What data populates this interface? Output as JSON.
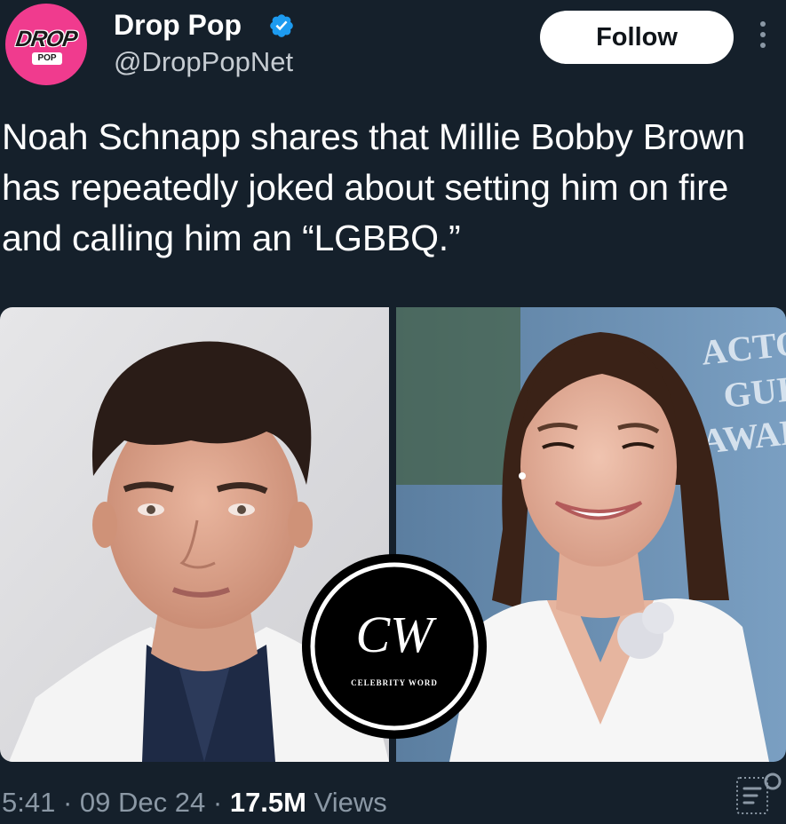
{
  "account": {
    "display_name": "Drop Pop",
    "handle": "@DropPopNet",
    "verified": true,
    "avatar": {
      "logo_text": "DROP",
      "logo_subtext": "POP",
      "background": "#f03b8e"
    }
  },
  "actions": {
    "follow_label": "Follow",
    "more_icon": "more-vertical-icon"
  },
  "tweet": {
    "text": "Noah Schnapp shares that Millie Bobby Brown has repeatedly joked about setting him on fire and calling him an “LGBBQ.”"
  },
  "media": {
    "watermark": {
      "monogram": "CW",
      "caption": "CELEBRITY WORD"
    },
    "backdrop_text": [
      "ACTOR",
      "GUIL",
      "AWARD"
    ]
  },
  "meta": {
    "time": "5:41",
    "separator": "·",
    "date": "09 Dec 24",
    "views_count": "17.5M",
    "views_label": "Views",
    "analytics_icon": "analytics-icon"
  },
  "colors": {
    "background": "#15202b",
    "accent": "#1d9bf0",
    "secondary_text": "#8b98a5",
    "brand_pink": "#f03b8e"
  }
}
